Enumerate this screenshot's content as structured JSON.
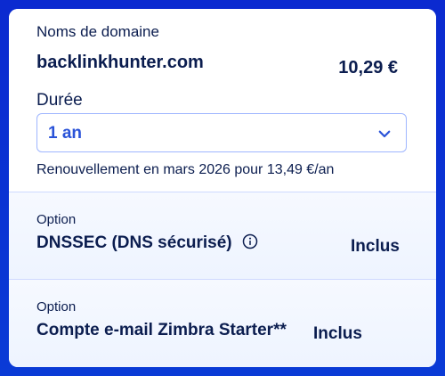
{
  "domain": {
    "heading": "Noms de domaine",
    "name": "backlinkhunter.com",
    "price": "10,29 €",
    "duration_label": "Durée",
    "duration_selected": "1 an",
    "renewal_text": "Renouvellement en mars 2026 pour 13,49 €/an"
  },
  "options": [
    {
      "label": "Option",
      "title": "DNSSEC (DNS sécurisé)",
      "status": "Inclus",
      "icon": "info-icon"
    },
    {
      "label": "Option",
      "title": "Compte e-mail Zimbra Starter**",
      "status": "Inclus"
    }
  ],
  "colors": {
    "background": "#0b2ad0",
    "text": "#0b1d4f",
    "accent": "#2a53d8",
    "option_bg": "#f6f9ff",
    "divider": "#cfd9ff"
  }
}
